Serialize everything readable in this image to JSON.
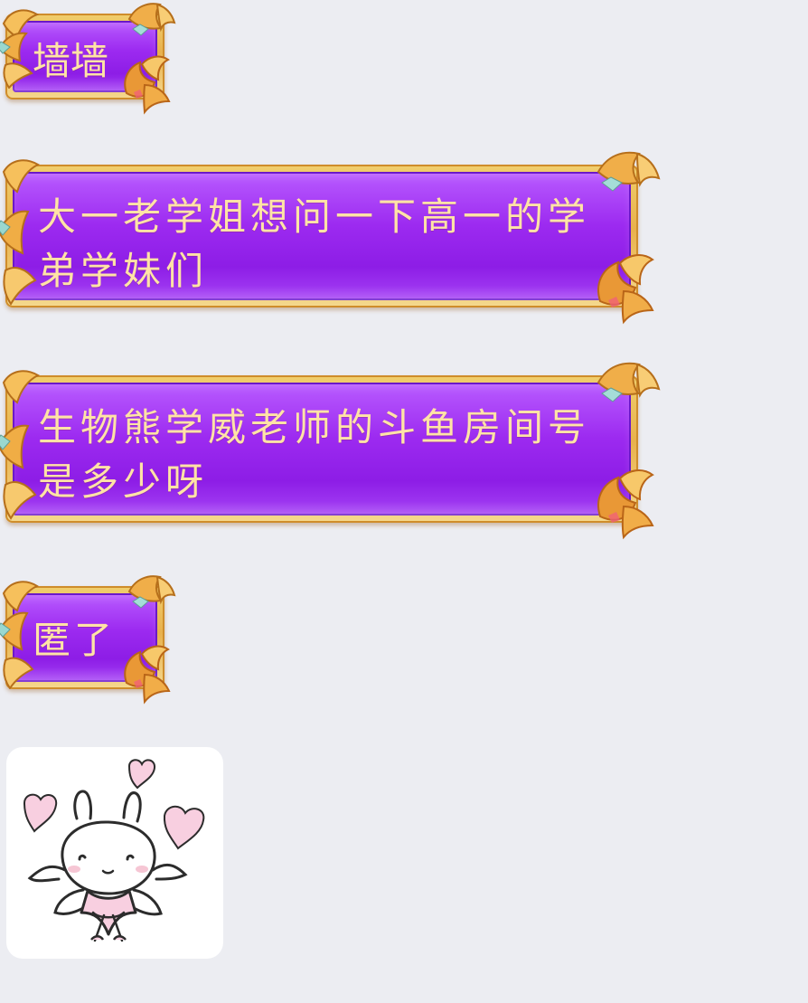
{
  "chat": {
    "messages": [
      {
        "text": "墙墙"
      },
      {
        "text": "大一老学姐想问一下高一的学弟学妹们"
      },
      {
        "text": "生物熊学威老师的斗鱼房间号是多少呀"
      },
      {
        "text": "匿了"
      }
    ],
    "sticker": {
      "icon": "cute-bunny-with-hearts-icon"
    }
  }
}
